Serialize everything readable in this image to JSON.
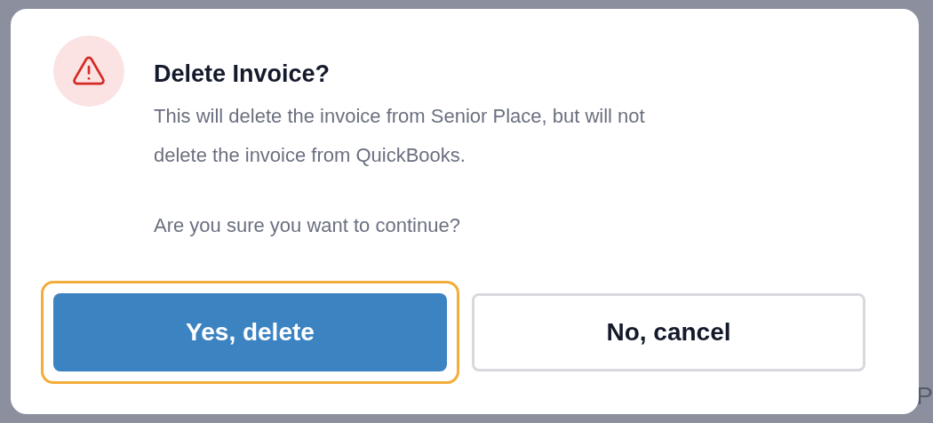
{
  "background": {
    "text_fragment": "P"
  },
  "dialog": {
    "title": "Delete Invoice?",
    "message": [
      "This will delete the invoice from Senior Place, but will not delete the invoice from QuickBooks.",
      "Are you sure you want to continue?"
    ],
    "buttons": [
      {
        "label": "Yes, delete",
        "kind": "primary",
        "focused": true
      },
      {
        "label": "No, cancel",
        "kind": "secondary",
        "focused": false
      }
    ]
  }
}
